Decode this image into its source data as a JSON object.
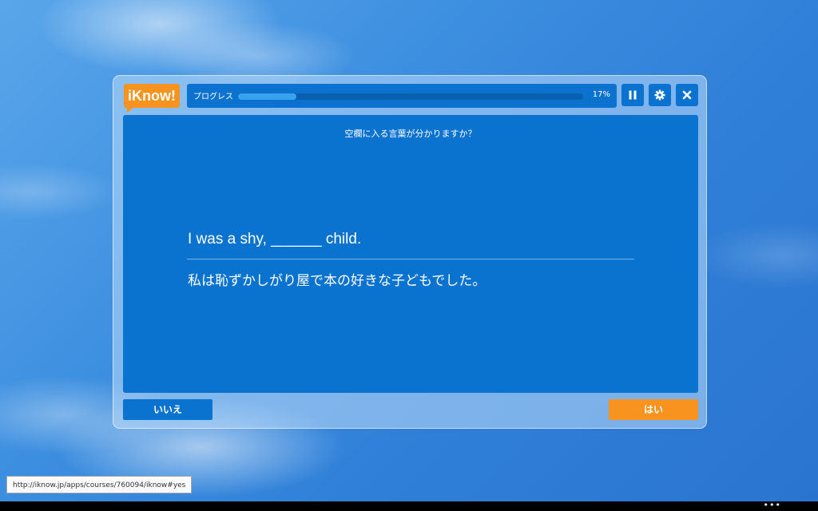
{
  "header": {
    "logo_text": "iKnow!",
    "progress_label": "プログレス",
    "progress_percent_text": "17%",
    "progress_fraction": 0.17,
    "pause_icon": "pause-icon",
    "settings_icon": "gear-icon",
    "close_icon": "close-icon"
  },
  "card": {
    "prompt": "空欄に入る言葉が分かりますか？",
    "sentence_en": "I was a shy, ______ child.",
    "sentence_ja": "私は恥ずかしがり屋で本の好きな子どもでした。"
  },
  "answers": {
    "no_label": "いいえ",
    "yes_label": "はい"
  },
  "status_bar": {
    "url": "http://iknow.jp/apps/courses/760094/iknow#yes"
  },
  "taskbar": {
    "more_glyph": "•••"
  },
  "colors": {
    "accent_orange": "#f7931e",
    "card_blue": "#0a73cf",
    "progress_fill": "#39a2ef"
  }
}
